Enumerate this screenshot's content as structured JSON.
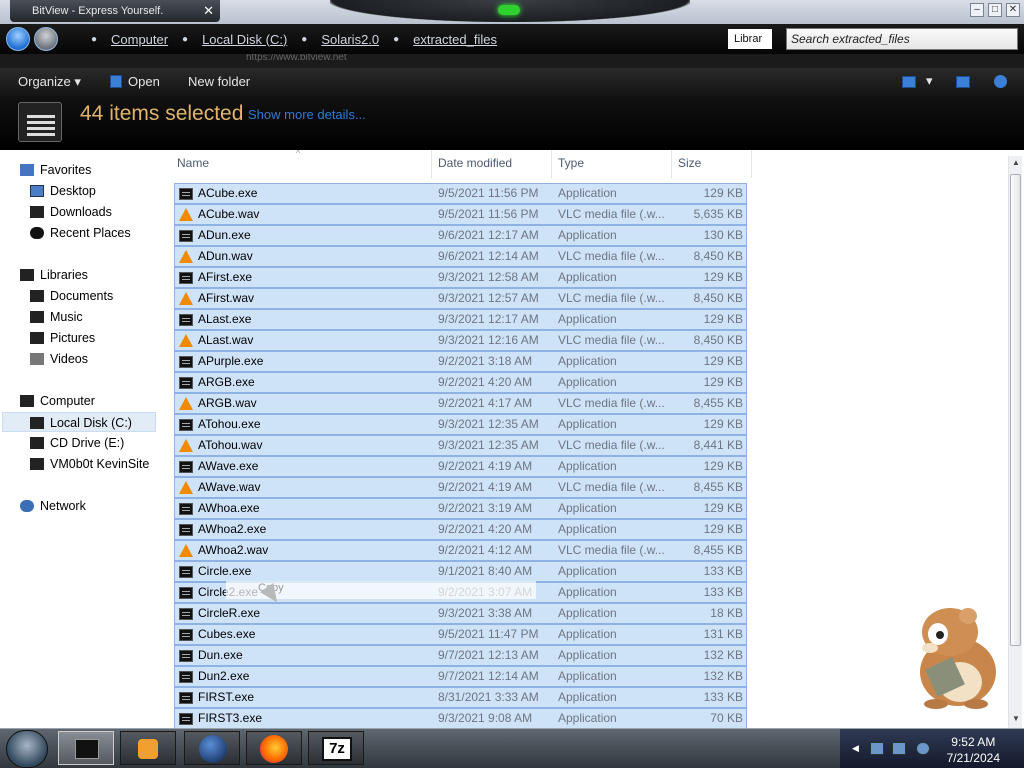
{
  "window": {
    "tab_title": "BitView - Express Yourself.",
    "tab_close": "✕",
    "controls": {
      "minimize": "–",
      "maximize": "□",
      "close": "✕"
    }
  },
  "address": {
    "crumbs": [
      "Computer",
      "Local Disk (C:)",
      "Solaris2.0",
      "extracted_files"
    ],
    "library_button": "Librar",
    "search_placeholder": "Search extracted_files"
  },
  "browser_strip": {
    "url_fragment": "https://www.bitview.net"
  },
  "toolbar": {
    "organize": "Organize",
    "open": "Open",
    "new_folder": "New folder"
  },
  "details": {
    "selection": "44 items selected",
    "more": "Show more details..."
  },
  "nav": {
    "favorites": {
      "label": "Favorites",
      "items": [
        "Desktop",
        "Downloads",
        "Recent Places"
      ]
    },
    "libraries": {
      "label": "Libraries",
      "items": [
        "Documents",
        "Music",
        "Pictures",
        "Videos"
      ]
    },
    "computer": {
      "label": "Computer",
      "items": [
        "Local Disk (C:)",
        "CD Drive (E:)",
        "VM0b0t KevinSite"
      ]
    },
    "network": {
      "label": "Network"
    }
  },
  "columns": {
    "name": "Name",
    "date": "Date modified",
    "type": "Type",
    "size": "Size"
  },
  "files": [
    {
      "name": "ACube.exe",
      "date": "9/5/2021 11:56 PM",
      "type": "Application",
      "size": "129 KB",
      "icon": "exe"
    },
    {
      "name": "ACube.wav",
      "date": "9/5/2021 11:56 PM",
      "type": "VLC media file (.w...",
      "size": "5,635 KB",
      "icon": "vlc"
    },
    {
      "name": "ADun.exe",
      "date": "9/6/2021 12:17 AM",
      "type": "Application",
      "size": "130 KB",
      "icon": "exe"
    },
    {
      "name": "ADun.wav",
      "date": "9/6/2021 12:14 AM",
      "type": "VLC media file (.w...",
      "size": "8,450 KB",
      "icon": "vlc"
    },
    {
      "name": "AFirst.exe",
      "date": "9/3/2021 12:58 AM",
      "type": "Application",
      "size": "129 KB",
      "icon": "exe"
    },
    {
      "name": "AFirst.wav",
      "date": "9/3/2021 12:57 AM",
      "type": "VLC media file (.w...",
      "size": "8,450 KB",
      "icon": "vlc"
    },
    {
      "name": "ALast.exe",
      "date": "9/3/2021 12:17 AM",
      "type": "Application",
      "size": "129 KB",
      "icon": "exe"
    },
    {
      "name": "ALast.wav",
      "date": "9/3/2021 12:16 AM",
      "type": "VLC media file (.w...",
      "size": "8,450 KB",
      "icon": "vlc"
    },
    {
      "name": "APurple.exe",
      "date": "9/2/2021 3:18 AM",
      "type": "Application",
      "size": "129 KB",
      "icon": "exe"
    },
    {
      "name": "ARGB.exe",
      "date": "9/2/2021 4:20 AM",
      "type": "Application",
      "size": "129 KB",
      "icon": "exe"
    },
    {
      "name": "ARGB.wav",
      "date": "9/2/2021 4:17 AM",
      "type": "VLC media file (.w...",
      "size": "8,455 KB",
      "icon": "vlc"
    },
    {
      "name": "ATohou.exe",
      "date": "9/3/2021 12:35 AM",
      "type": "Application",
      "size": "129 KB",
      "icon": "exe"
    },
    {
      "name": "ATohou.wav",
      "date": "9/3/2021 12:35 AM",
      "type": "VLC media file (.w...",
      "size": "8,441 KB",
      "icon": "vlc"
    },
    {
      "name": "AWave.exe",
      "date": "9/2/2021 4:19 AM",
      "type": "Application",
      "size": "129 KB",
      "icon": "exe"
    },
    {
      "name": "AWave.wav",
      "date": "9/2/2021 4:19 AM",
      "type": "VLC media file (.w...",
      "size": "8,455 KB",
      "icon": "vlc"
    },
    {
      "name": "AWhoa.exe",
      "date": "9/2/2021 3:19 AM",
      "type": "Application",
      "size": "129 KB",
      "icon": "exe"
    },
    {
      "name": "AWhoa2.exe",
      "date": "9/2/2021 4:20 AM",
      "type": "Application",
      "size": "129 KB",
      "icon": "exe"
    },
    {
      "name": "AWhoa2.wav",
      "date": "9/2/2021 4:12 AM",
      "type": "VLC media file (.w...",
      "size": "8,455 KB",
      "icon": "vlc"
    },
    {
      "name": "Circle.exe",
      "date": "9/1/2021 8:40 AM",
      "type": "Application",
      "size": "133 KB",
      "icon": "exe"
    },
    {
      "name": "Circle2.exe",
      "date": "9/2/2021 3:07 AM",
      "type": "Application",
      "size": "133 KB",
      "icon": "exe"
    },
    {
      "name": "CircleR.exe",
      "date": "9/3/2021 3:38 AM",
      "type": "Application",
      "size": "18 KB",
      "icon": "exe"
    },
    {
      "name": "Cubes.exe",
      "date": "9/5/2021 11:47 PM",
      "type": "Application",
      "size": "131 KB",
      "icon": "exe"
    },
    {
      "name": "Dun.exe",
      "date": "9/7/2021 12:13 AM",
      "type": "Application",
      "size": "132 KB",
      "icon": "exe"
    },
    {
      "name": "Dun2.exe",
      "date": "9/7/2021 12:14 AM",
      "type": "Application",
      "size": "132 KB",
      "icon": "exe"
    },
    {
      "name": "FIRST.exe",
      "date": "8/31/2021 3:33 AM",
      "type": "Application",
      "size": "133 KB",
      "icon": "exe"
    },
    {
      "name": "FIRST3.exe",
      "date": "9/3/2021 9:08 AM",
      "type": "Application",
      "size": "70 KB",
      "icon": "exe"
    }
  ],
  "drag_tooltip": "Copy",
  "taskbar": {
    "apps": [
      "window-app-icon",
      "media-player-icon",
      "globe-browser-icon",
      "firefox-icon",
      "7zip-icon"
    ],
    "app_7zip_label": "7z",
    "time": "9:52 AM",
    "date": "7/21/2024"
  },
  "colors": {
    "selection_fill": "#cfe3f8",
    "selection_border": "#8db2e3",
    "details_text": "#e0b56a",
    "link": "#2f7bd9"
  }
}
